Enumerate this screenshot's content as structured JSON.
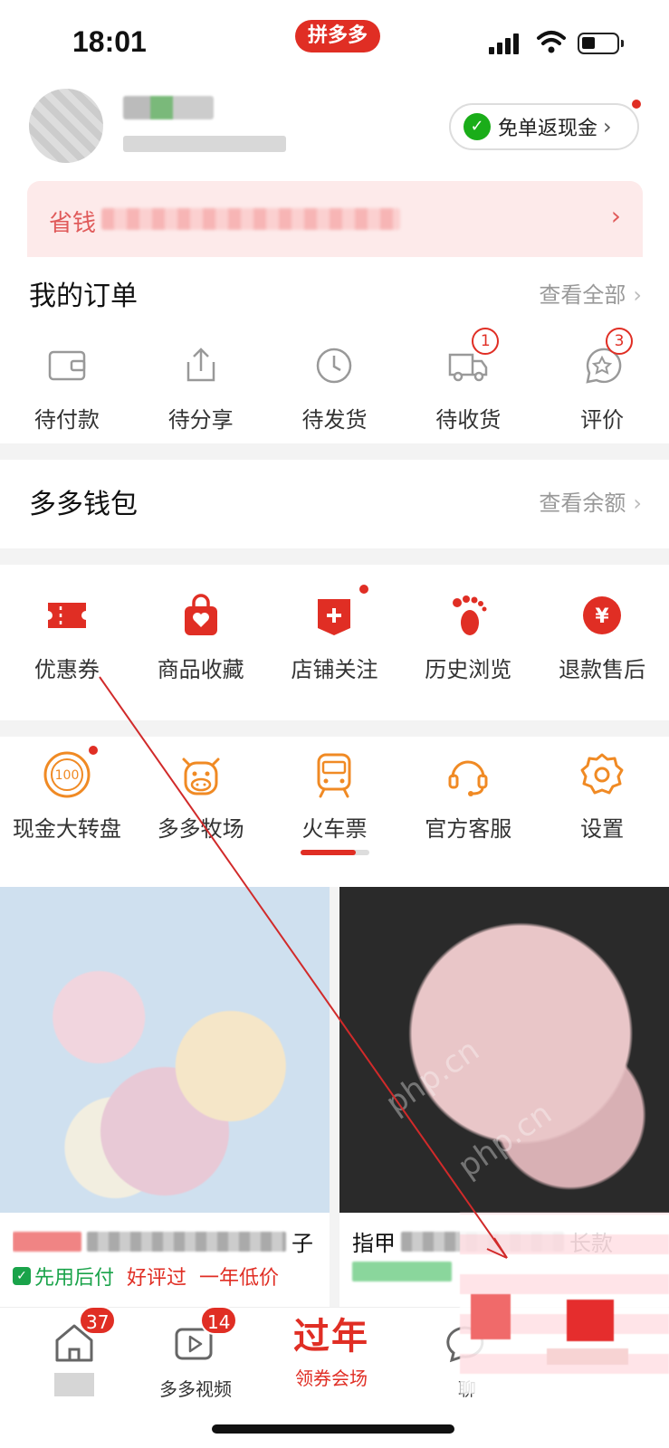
{
  "status_bar": {
    "time": "18:01",
    "app_name": "拼多多"
  },
  "profile": {
    "cashback_label": "免单返现金"
  },
  "savings_banner": {
    "label": "省钱"
  },
  "orders": {
    "title": "我的订单",
    "link": "查看全部",
    "items": [
      {
        "label": "待付款",
        "icon": "wallet-icon"
      },
      {
        "label": "待分享",
        "icon": "share-icon"
      },
      {
        "label": "待发货",
        "icon": "clock-icon"
      },
      {
        "label": "待收货",
        "icon": "truck-icon",
        "badge": "1"
      },
      {
        "label": "评价",
        "icon": "review-icon",
        "badge": "3"
      }
    ]
  },
  "wallet": {
    "title": "多多钱包",
    "link": "查看余额"
  },
  "services": {
    "items": [
      {
        "label": "优惠券",
        "icon": "coupon-icon"
      },
      {
        "label": "商品收藏",
        "icon": "favorites-bag-icon"
      },
      {
        "label": "店铺关注",
        "icon": "store-follow-icon"
      },
      {
        "label": "历史浏览",
        "icon": "footprint-icon"
      },
      {
        "label": "退款售后",
        "icon": "refund-icon"
      }
    ]
  },
  "tools": {
    "items": [
      {
        "label": "现金大转盘",
        "icon": "wheel-icon",
        "glyph": "100"
      },
      {
        "label": "多多牧场",
        "icon": "cow-icon"
      },
      {
        "label": "火车票",
        "icon": "train-icon"
      },
      {
        "label": "官方客服",
        "icon": "headset-icon"
      },
      {
        "label": "设置",
        "icon": "gear-icon"
      }
    ],
    "scroll_progress": 0.8
  },
  "products": [
    {
      "title_suffix": "子",
      "tags": [
        "先用后付",
        "好评过",
        "一年低价"
      ]
    },
    {
      "title_prefix": "指甲",
      "title_suffix": "长款"
    }
  ],
  "bottom_nav": {
    "items": [
      {
        "label": "",
        "icon": "home-icon",
        "badge": "37"
      },
      {
        "label": "多多视频",
        "icon": "video-icon",
        "badge": "14"
      },
      {
        "label": "领券会场",
        "big": "过年"
      },
      {
        "label": "聊",
        "icon": "chat-icon"
      }
    ]
  },
  "watermark": "php.cn",
  "colors": {
    "brand": "#e02e24",
    "orange_icon": "#f08a24",
    "green": "#1aa34a"
  }
}
